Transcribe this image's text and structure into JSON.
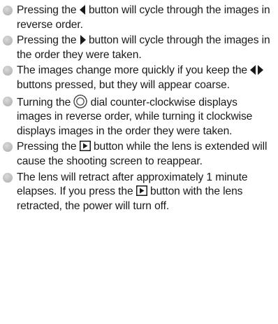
{
  "bullets": [
    {
      "before": "Pressing the ",
      "icon": "left-arrow-icon",
      "after": " button will cycle through the images in reverse order."
    },
    {
      "before": "Pressing the ",
      "icon": "right-arrow-icon",
      "after": " button will cycle through the images in the order they were taken."
    },
    {
      "before": "The images change more quickly if you keep the ",
      "icon": "left-right-arrows-icon",
      "after": " buttons pressed, but they will appear coarse."
    },
    {
      "before": "Turning the ",
      "icon": "control-dial-icon",
      "after": " dial counter-clockwise displays images in reverse order, while turning it clockwise displays images in the order they were taken."
    },
    {
      "before": "Pressing the ",
      "icon": "playback-icon",
      "after": " button while the lens is extended will cause the shooting screen to reappear."
    },
    {
      "before": "The lens will retract after approximately 1 minute elapses. If you press the ",
      "icon": "playback-icon",
      "after": " button with the lens retracted, the power will turn off."
    }
  ],
  "colors": {
    "text": "#1a1a1a",
    "bullet": "#bdbdbd"
  }
}
